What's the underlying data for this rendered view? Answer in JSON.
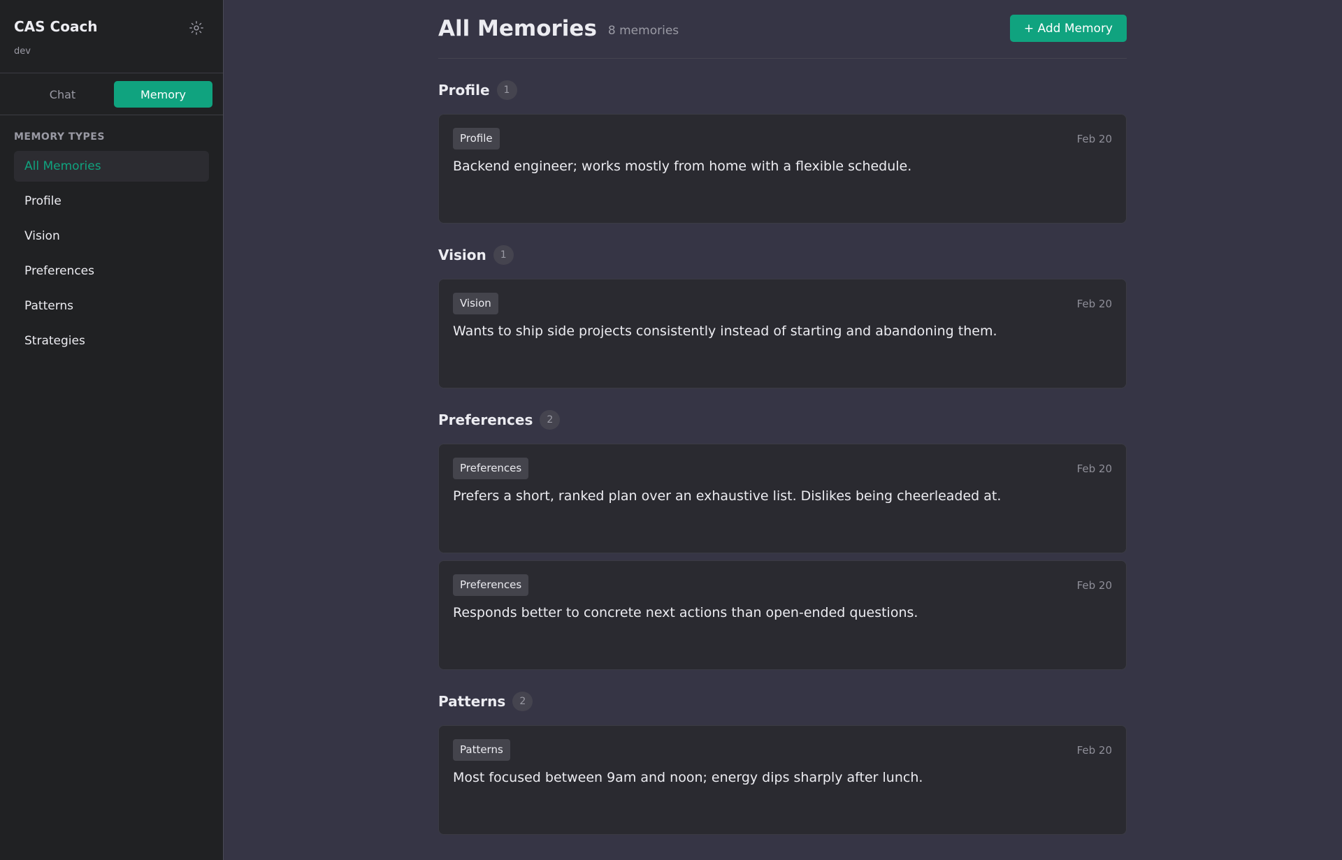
{
  "sidebar": {
    "app_title": "CAS Coach",
    "env": "dev",
    "settings_icon": "gear-icon",
    "modes": [
      {
        "label": "Chat",
        "active": false
      },
      {
        "label": "Memory",
        "active": true
      }
    ],
    "section_title": "MEMORY TYPES",
    "items": [
      {
        "label": "All Memories",
        "active": true
      },
      {
        "label": "Profile",
        "active": false
      },
      {
        "label": "Vision",
        "active": false
      },
      {
        "label": "Preferences",
        "active": false
      },
      {
        "label": "Patterns",
        "active": false
      },
      {
        "label": "Strategies",
        "active": false
      }
    ]
  },
  "header": {
    "title": "All Memories",
    "count": "8 memories",
    "add_label": "+ Add Memory"
  },
  "groups": [
    {
      "title": "Profile",
      "count": "1",
      "cards": [
        {
          "tag": "Profile",
          "date": "Feb 20",
          "text": "Backend engineer; works mostly from home with a flexible schedule."
        }
      ]
    },
    {
      "title": "Vision",
      "count": "1",
      "cards": [
        {
          "tag": "Vision",
          "date": "Feb 20",
          "text": "Wants to ship side projects consistently instead of starting and abandoning them."
        }
      ]
    },
    {
      "title": "Preferences",
      "count": "2",
      "cards": [
        {
          "tag": "Preferences",
          "date": "Feb 20",
          "text": "Prefers a short, ranked plan over an exhaustive list. Dislikes being cheerleaded at."
        },
        {
          "tag": "Preferences",
          "date": "Feb 20",
          "text": "Responds better to concrete next actions than open-ended questions."
        }
      ]
    },
    {
      "title": "Patterns",
      "count": "2",
      "cards": [
        {
          "tag": "Patterns",
          "date": "Feb 20",
          "text": "Most focused between 9am and noon; energy dips sharply after lunch."
        }
      ]
    }
  ],
  "colors": {
    "accent": "#10a37f",
    "sidebar_bg": "#202123",
    "main_bg": "#363545",
    "card_bg": "#2a2a30"
  }
}
